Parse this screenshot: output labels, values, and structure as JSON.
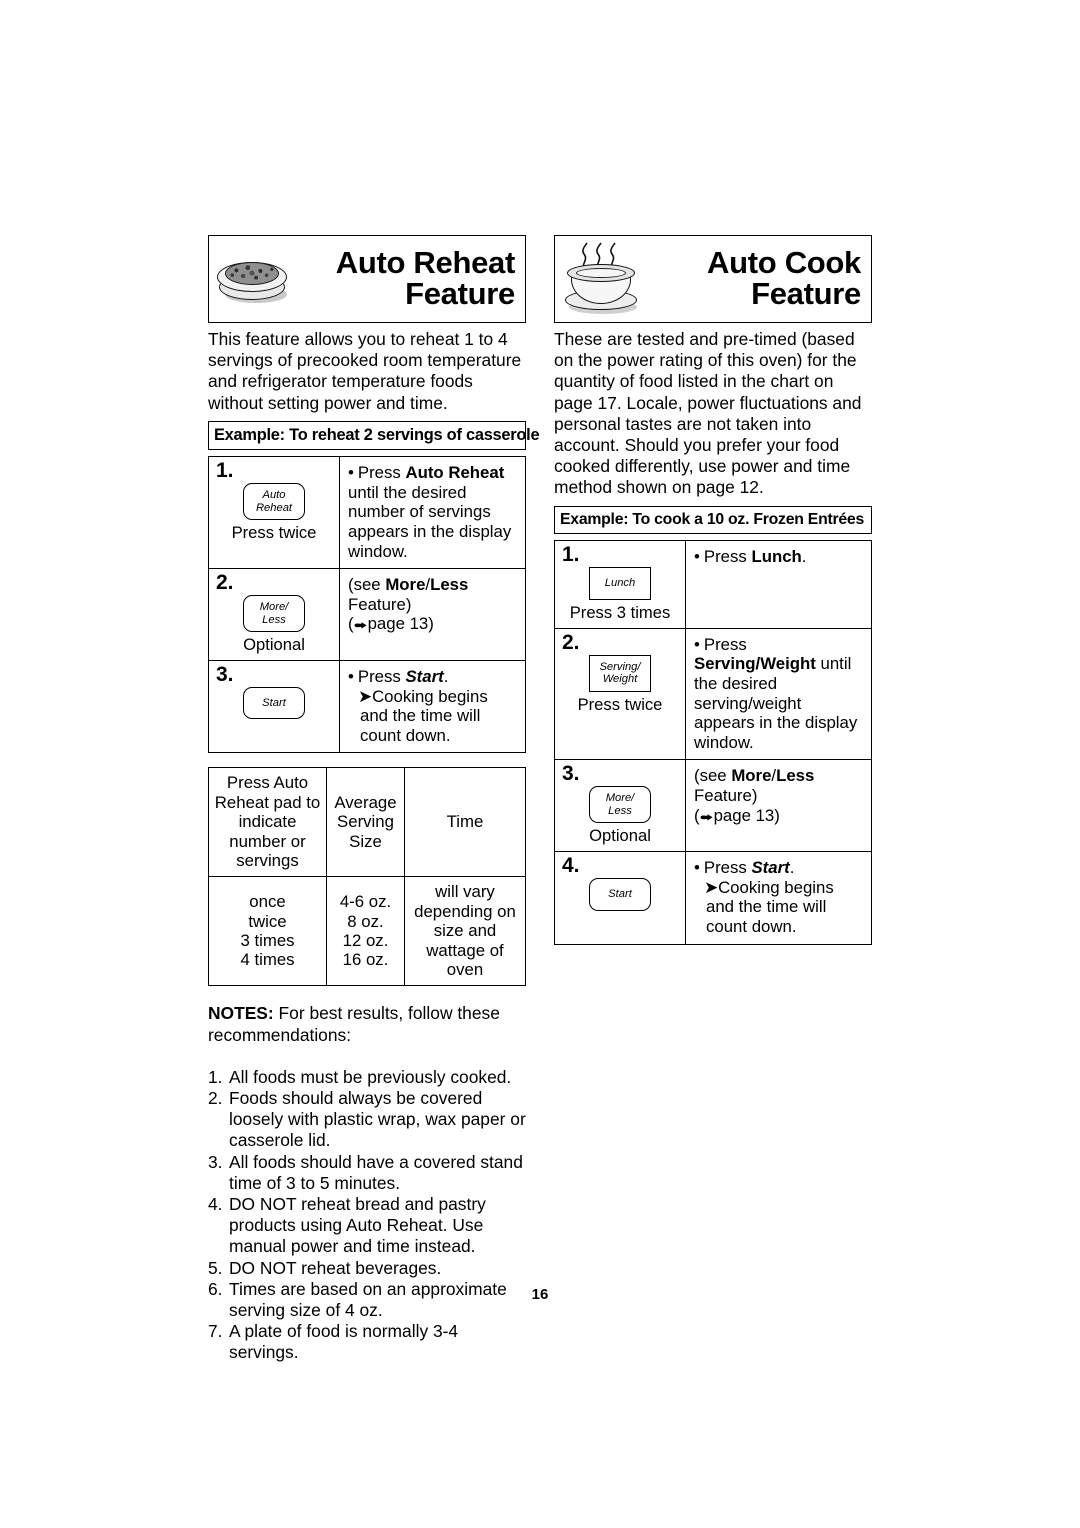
{
  "page": {
    "number": "16"
  },
  "left_column": {
    "banner": {
      "icon": "plate-of-food-icon",
      "title_line1": "Auto Reheat",
      "title_line2": "Feature"
    },
    "intro": "This feature allows you to reheat 1 to 4 servings of precooked room temperature and refrigerator temperature foods without setting power and time.",
    "example_caption": "Example: To reheat  2 servings of casserole",
    "steps": [
      {
        "number": "1.",
        "key_label_line1": "Auto",
        "key_label_line2": "Reheat",
        "key_shape": "rounded",
        "press_label": "Press twice",
        "text_bullet": "Press ",
        "text_bold": "Auto Reheat",
        "text_rest": " until the desired number of servings appears in the display window."
      },
      {
        "number": "2.",
        "key_label_line1": "More/",
        "key_label_line2": "Less",
        "key_shape": "rounded",
        "press_label": "Optional",
        "text_line1_pre": "(see ",
        "text_line1_bold1": "More",
        "text_line1_sep": "/",
        "text_line1_bold2": "Less",
        "text_line2": "Feature)",
        "text_line3": "page 13)"
      },
      {
        "number": "3.",
        "key_label_line1": "Start",
        "key_label_line2": "",
        "key_shape": "rounded",
        "press_label": "",
        "text_bullet": "Press ",
        "text_bolditalic": "Start",
        "text_period": ".",
        "text_arrow": "Cooking begins and the time will count down."
      }
    ],
    "size_table": {
      "headers": [
        "Press Auto Reheat pad to indicate number or servings",
        "Average Serving Size",
        "Time"
      ],
      "rows_col1": [
        "once",
        "twice",
        "3 times",
        "4 times"
      ],
      "rows_col2": [
        "4-6 oz.",
        "8 oz.",
        "12 oz.",
        "16 oz."
      ],
      "rows_col3": [
        "will vary",
        "depending on",
        "size and",
        "wattage of oven"
      ]
    },
    "notes": {
      "heading_bold": "NOTES:",
      "heading_rest": " For best results, follow these recommendations:",
      "items": [
        {
          "num": "1.",
          "text": "All foods must be previously cooked."
        },
        {
          "num": "2.",
          "text": "Foods should always be covered loosely with plastic wrap, wax paper or casserole lid."
        },
        {
          "num": "3.",
          "text": "All foods should have a covered stand time of 3 to 5 minutes."
        },
        {
          "num": "4.",
          "text": "DO NOT reheat bread and pastry products using Auto Reheat. Use manual power and time instead."
        },
        {
          "num": "5.",
          "text": "DO NOT reheat beverages."
        },
        {
          "num": "6.",
          "text": "Times are based on an approximate serving size of 4 oz."
        },
        {
          "num": "7.",
          "text": "A plate of food is normally 3-4 servings."
        }
      ]
    }
  },
  "right_column": {
    "banner": {
      "icon": "steaming-bowl-icon",
      "title_line1": "Auto Cook",
      "title_line2": "Feature"
    },
    "intro": "These are tested and pre-timed (based on the power rating of this oven) for the quantity of food listed in the chart on page 17. Locale, power fluctuations and personal tastes are not taken into account. Should you prefer your food cooked differently, use power and time method shown on page 12.",
    "example_caption": "Example: To cook a 10 oz. Frozen Entrées",
    "steps": [
      {
        "number": "1.",
        "key_label_line1": "Lunch",
        "key_label_line2": "",
        "key_shape": "square",
        "press_label": "Press 3 times",
        "text_bullet": "Press ",
        "text_bold": "Lunch",
        "text_rest": "."
      },
      {
        "number": "2.",
        "key_label_line1": "Serving/",
        "key_label_line2": "Weight",
        "key_shape": "square",
        "press_label": "Press twice",
        "text_bullet": "Press ",
        "text_bold": "Serving/Weight",
        "text_rest": " until the desired serving/weight appears in the display window."
      },
      {
        "number": "3.",
        "key_label_line1": "More/",
        "key_label_line2": "Less",
        "key_shape": "rounded",
        "press_label": "Optional",
        "text_line1_pre": "(see ",
        "text_line1_bold1": "More",
        "text_line1_sep": "/",
        "text_line1_bold2": "Less",
        "text_line2": "Feature)",
        "text_line3": "page 13)"
      },
      {
        "number": "4.",
        "key_label_line1": "Start",
        "key_label_line2": "",
        "key_shape": "rounded",
        "press_label": "",
        "text_bullet": "Press ",
        "text_bolditalic": "Start",
        "text_period": ".",
        "text_arrow": "Cooking begins and the time will count down."
      }
    ]
  }
}
